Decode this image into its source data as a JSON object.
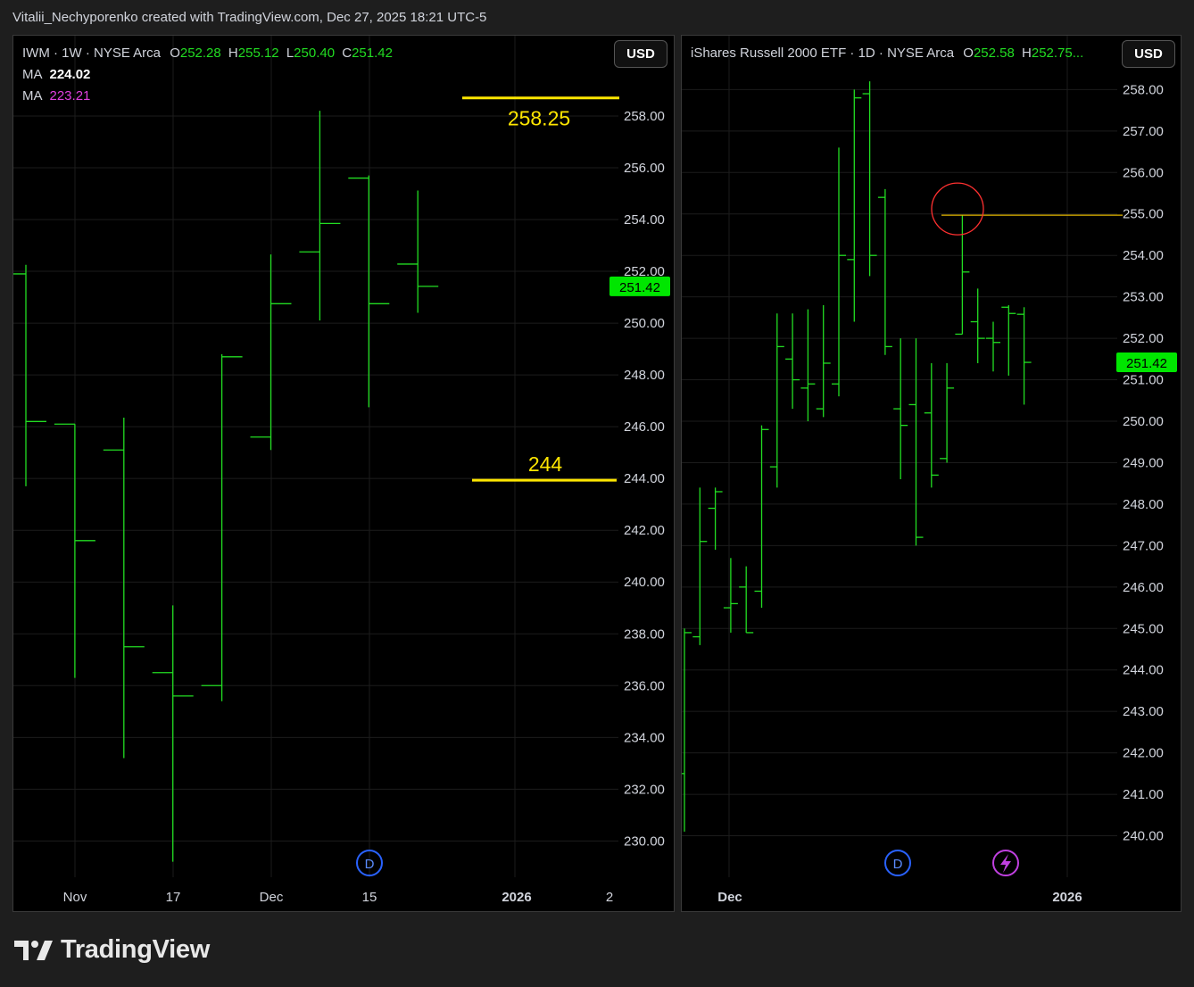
{
  "header_line": "Vitalii_Nechyporenko created with TradingView.com, Dec 27, 2025 18:21 UTC-5",
  "brand": "TradingView",
  "colors": {
    "bar": "#22dd22",
    "price_tag": "#00e600",
    "yellow": "#ffe600",
    "ma2": "#e040e0",
    "circle": "#ff3030"
  },
  "left": {
    "symbol_prefix": "IWM · 1W · NYSE Arca",
    "ohlc": [
      {
        "k": "O",
        "v": "252.28"
      },
      {
        "k": "H",
        "v": "255.12"
      },
      {
        "k": "L",
        "v": "250.40"
      },
      {
        "k": "C",
        "v": "251.42"
      }
    ],
    "ma": [
      {
        "label": "MA",
        "value": "224.02",
        "color": "#ffffff"
      },
      {
        "label": "MA",
        "value": "223.21",
        "color": "#e040e0"
      }
    ],
    "currency": "USD",
    "last_price": "251.42",
    "annotations": [
      {
        "text": "258.25",
        "value": 258.25
      },
      {
        "text": "244",
        "value": 244
      }
    ]
  },
  "right": {
    "symbol_prefix": "iShares Russell 2000 ETF · 1D · NYSE Arca",
    "ohlc": [
      {
        "k": "O",
        "v": "252.58"
      },
      {
        "k": "H",
        "v": "252.75..."
      }
    ],
    "currency": "USD",
    "last_price": "251.42",
    "level_line": 254.97
  },
  "chart_data": [
    {
      "type": "ohlc",
      "ylim": [
        228.6,
        261.1
      ],
      "y_ticks": [
        "230.00",
        "232.00",
        "234.00",
        "236.00",
        "238.00",
        "240.00",
        "242.00",
        "244.00",
        "246.00",
        "248.00",
        "250.00",
        "252.00",
        "254.00",
        "256.00",
        "258.00"
      ],
      "x_ticks": [
        "Nov",
        "17",
        "Dec",
        "15",
        "2026",
        "2"
      ],
      "bars": [
        {
          "o": 251.9,
          "h": 252.25,
          "l": 243.7,
          "c": 246.2
        },
        {
          "o": 246.1,
          "h": 246.1,
          "l": 236.3,
          "c": 241.6
        },
        {
          "o": 245.1,
          "h": 246.35,
          "l": 233.2,
          "c": 237.5
        },
        {
          "o": 236.5,
          "h": 239.1,
          "l": 229.2,
          "c": 235.6
        },
        {
          "o": 236.0,
          "h": 248.8,
          "l": 235.4,
          "c": 248.7
        },
        {
          "o": 245.6,
          "h": 252.65,
          "l": 245.1,
          "c": 250.75
        },
        {
          "o": 252.75,
          "h": 258.2,
          "l": 250.1,
          "c": 253.85
        },
        {
          "o": 255.6,
          "h": 255.7,
          "l": 246.75,
          "c": 250.75
        },
        {
          "o": 252.28,
          "h": 255.12,
          "l": 250.4,
          "c": 251.42
        }
      ]
    },
    {
      "type": "ohlc",
      "ylim": [
        239.0,
        259.3
      ],
      "y_ticks": [
        "240.00",
        "241.00",
        "242.00",
        "243.00",
        "244.00",
        "245.00",
        "246.00",
        "247.00",
        "248.00",
        "249.00",
        "250.00",
        "251.00",
        "252.00",
        "253.00",
        "254.00",
        "255.00",
        "256.00",
        "257.00",
        "258.00"
      ],
      "x_ticks": [
        "Dec",
        "2026"
      ],
      "bars": [
        {
          "o": 241.5,
          "h": 245.0,
          "l": 240.1,
          "c": 244.9
        },
        {
          "o": 244.8,
          "h": 248.4,
          "l": 244.6,
          "c": 247.1
        },
        {
          "o": 247.9,
          "h": 248.4,
          "l": 246.9,
          "c": 248.3
        },
        {
          "o": 245.5,
          "h": 246.7,
          "l": 244.9,
          "c": 245.6
        },
        {
          "o": 246.0,
          "h": 246.5,
          "l": 244.9,
          "c": 244.9
        },
        {
          "o": 245.9,
          "h": 249.9,
          "l": 245.5,
          "c": 249.8
        },
        {
          "o": 248.9,
          "h": 252.6,
          "l": 248.4,
          "c": 251.8
        },
        {
          "o": 251.5,
          "h": 252.6,
          "l": 250.3,
          "c": 251.0
        },
        {
          "o": 250.8,
          "h": 252.7,
          "l": 250.0,
          "c": 250.9
        },
        {
          "o": 250.3,
          "h": 252.8,
          "l": 250.1,
          "c": 251.4
        },
        {
          "o": 250.9,
          "h": 256.6,
          "l": 250.6,
          "c": 254.0
        },
        {
          "o": 253.9,
          "h": 258.0,
          "l": 252.4,
          "c": 257.8
        },
        {
          "o": 257.9,
          "h": 258.2,
          "l": 253.5,
          "c": 254.0
        },
        {
          "o": 255.4,
          "h": 255.6,
          "l": 251.6,
          "c": 251.8
        },
        {
          "o": 250.3,
          "h": 252.0,
          "l": 248.6,
          "c": 249.9
        },
        {
          "o": 250.4,
          "h": 252.0,
          "l": 247.0,
          "c": 247.2
        },
        {
          "o": 250.2,
          "h": 251.4,
          "l": 248.4,
          "c": 248.7
        },
        {
          "o": 249.1,
          "h": 251.4,
          "l": 249.0,
          "c": 250.8
        },
        {
          "o": 252.1,
          "h": 254.97,
          "l": 252.1,
          "c": 253.6
        },
        {
          "o": 252.4,
          "h": 253.2,
          "l": 251.4,
          "c": 252.0
        },
        {
          "o": 252.0,
          "h": 252.4,
          "l": 251.2,
          "c": 251.9
        },
        {
          "o": 252.75,
          "h": 252.8,
          "l": 251.1,
          "c": 252.6
        },
        {
          "o": 252.58,
          "h": 252.75,
          "l": 250.4,
          "c": 251.42
        }
      ]
    }
  ]
}
